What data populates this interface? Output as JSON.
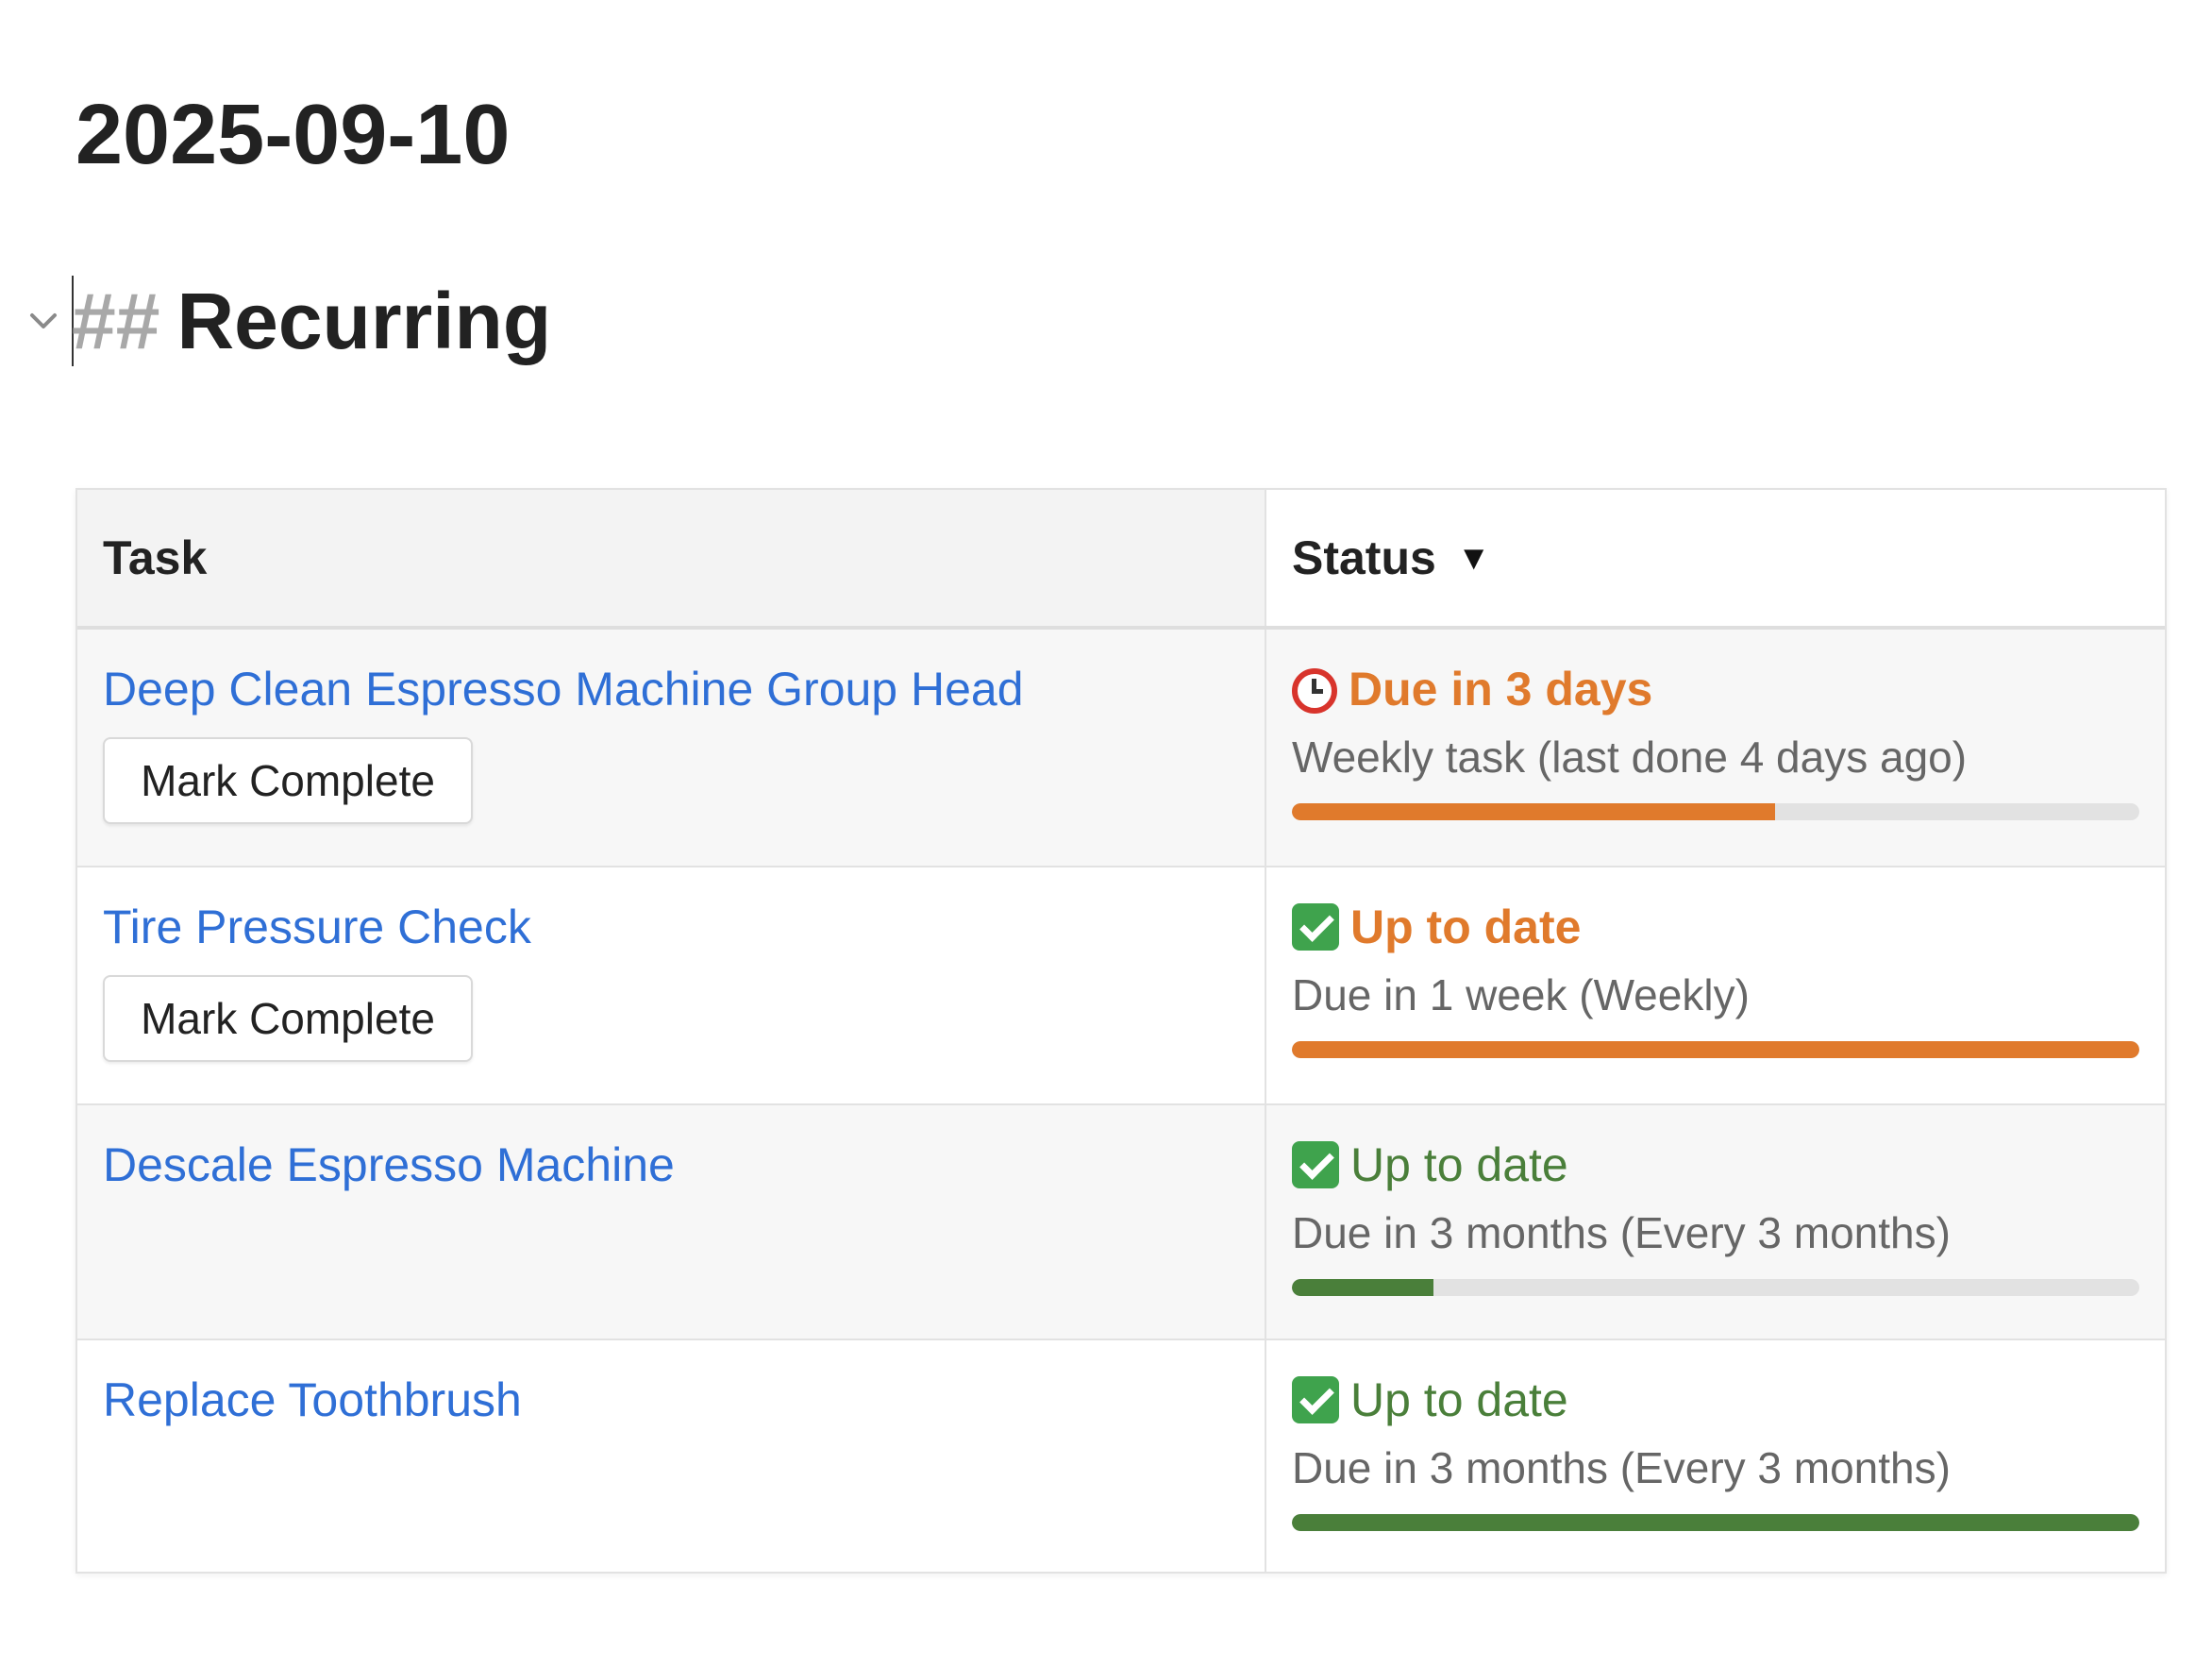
{
  "page": {
    "title": "2025-09-10"
  },
  "section": {
    "marker": "##",
    "heading": "Recurring",
    "toggle_icon": "chevron-down-icon"
  },
  "table": {
    "headers": {
      "task": "Task",
      "status": "Status",
      "sort_icon": "▼"
    },
    "rows": [
      {
        "task": "Deep Clean Espresso Machine Group Head",
        "button": "Mark Complete",
        "status_icon": "alarm-clock-icon",
        "status": "Due in 3 days",
        "status_color": "#e07a2c",
        "status_bold": true,
        "detail": "Weekly task (last done 4 days ago)",
        "progress": 0.57,
        "progress_color": "#e07a2c"
      },
      {
        "task": "Tire Pressure Check",
        "button": "Mark Complete",
        "status_icon": "check-icon",
        "status": "Up to date",
        "status_color": "#e07a2c",
        "status_bold": true,
        "detail": "Due in 1 week (Weekly)",
        "progress": 1.0,
        "progress_color": "#e07a2c"
      },
      {
        "task": "Descale Espresso Machine",
        "button": "",
        "status_icon": "check-icon",
        "status": "Up to date",
        "status_color": "#4a7f3a",
        "status_bold": false,
        "detail": "Due in 3 months (Every 3 months)",
        "progress": 0.167,
        "progress_color": "#4a7f3a"
      },
      {
        "task": "Replace Toothbrush",
        "button": "",
        "status_icon": "check-icon",
        "status": "Up to date",
        "status_color": "#4a7f3a",
        "status_bold": false,
        "detail": "Due in 3 months (Every 3 months)",
        "progress": 1.0,
        "progress_color": "#4a7f3a"
      }
    ]
  },
  "colors": {
    "link": "#2f6fd6",
    "header_bg": "#f3f3f3",
    "alt_row_bg": "#f7f7f7",
    "track": "#e2e2e2"
  }
}
